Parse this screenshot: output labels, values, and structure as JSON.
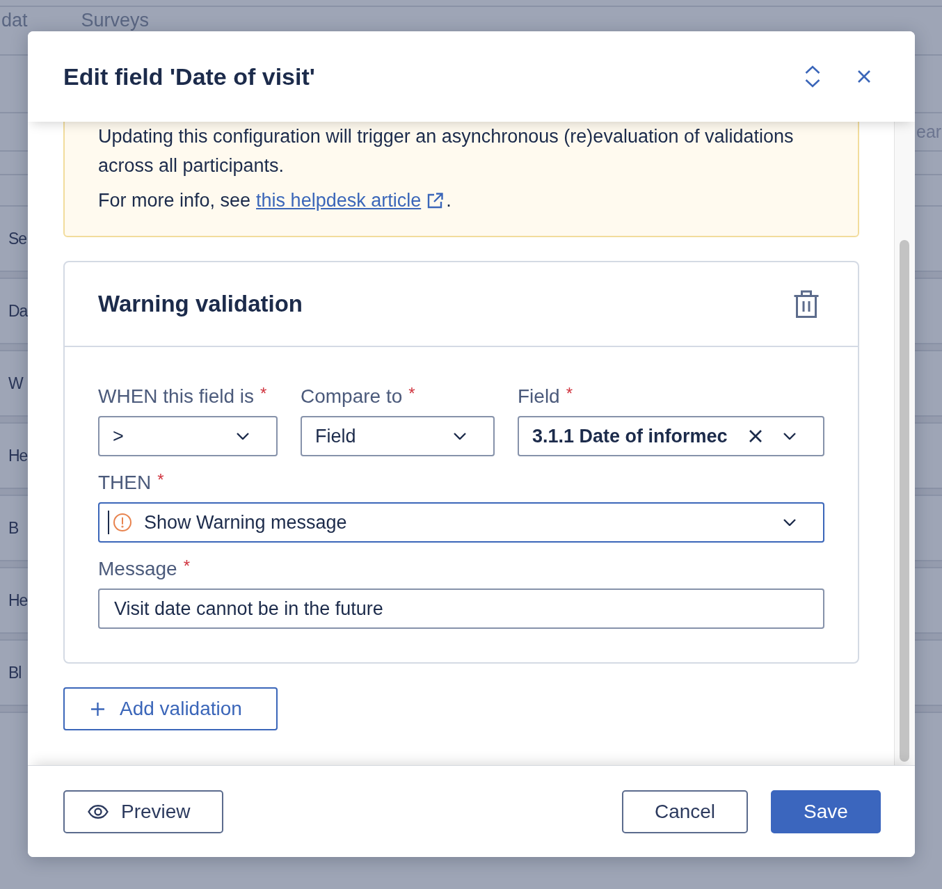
{
  "background": {
    "tabs": [
      "dat",
      "Surveys"
    ],
    "search": {
      "placeholder": "ear"
    },
    "rows": [
      "Se",
      "Da",
      "W",
      "He",
      "B",
      "He",
      "Bl"
    ]
  },
  "dialog": {
    "title": "Edit field 'Date of visit'",
    "notice": {
      "text": "Updating this configuration will trigger an asynchronous (re)evaluation of validations across all participants.",
      "info_text": "For more info, see",
      "link": "this helpdesk article",
      "info_end": "."
    },
    "validations": [
      {
        "title": "Warning validation",
        "selects": [
          {
            "label": "WHEN this field is",
            "required_mark": "*",
            "value": ">",
            "kind": "plain"
          },
          {
            "label": "Compare to",
            "required_mark": "*",
            "value": "Field",
            "kind": "plain"
          },
          {
            "label": "Field",
            "required_mark": "*",
            "value": "3.1.1 Date of informec",
            "kind": "reference"
          }
        ],
        "action": {
          "label": "THEN",
          "required_mark": "*",
          "value": "Show Warning message",
          "focused": true
        },
        "message": {
          "label": "Message",
          "required_mark": "*",
          "value": "Visit date cannot be in the future"
        }
      }
    ],
    "add_button": "Add validation",
    "footer": {
      "preview_button": "Preview",
      "cancel_button": "Cancel",
      "save_button": "Save"
    }
  }
}
